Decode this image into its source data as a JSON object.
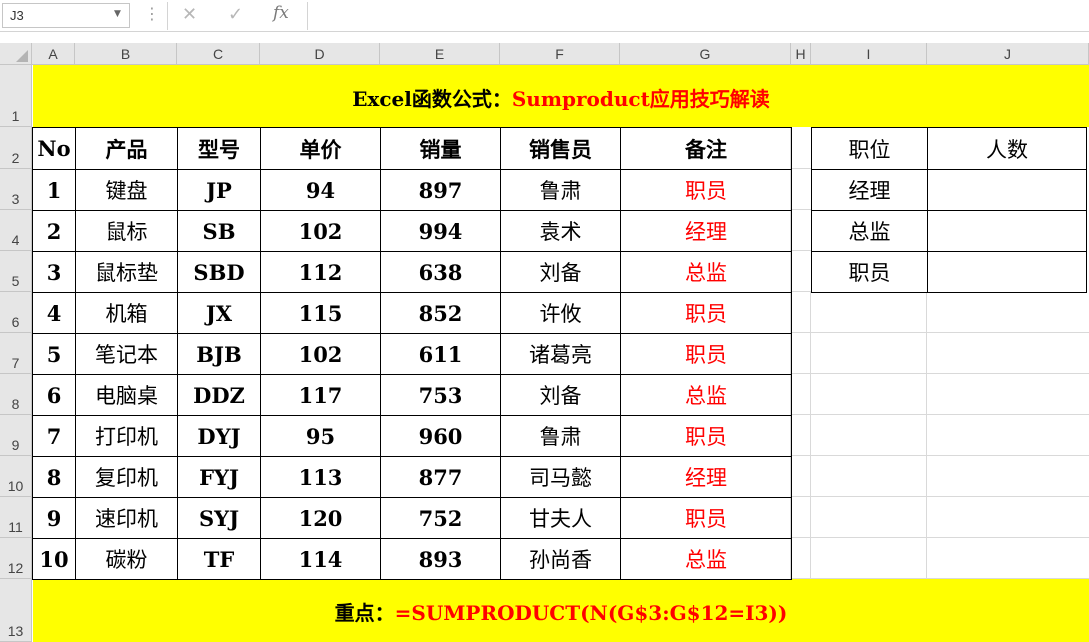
{
  "formula_bar": {
    "name_box": "J3",
    "cancel_icon": "✕",
    "enter_icon": "✓",
    "fx_label": "fx",
    "formula": ""
  },
  "columns": [
    "A",
    "B",
    "C",
    "D",
    "E",
    "F",
    "G",
    "H",
    "I",
    "J"
  ],
  "rows": [
    "1",
    "2",
    "3",
    "4",
    "5",
    "6",
    "7",
    "8",
    "9",
    "10",
    "11",
    "12",
    "13"
  ],
  "title": {
    "part1": "Excel函数公式：",
    "part2": "Sumproduct应用技巧解读"
  },
  "main_table": {
    "headers": [
      "No",
      "产品",
      "型号",
      "单价",
      "销量",
      "销售员",
      "备注"
    ],
    "rows": [
      [
        "1",
        "键盘",
        "JP",
        "94",
        "897",
        "鲁肃",
        "职员"
      ],
      [
        "2",
        "鼠标",
        "SB",
        "102",
        "994",
        "袁术",
        "经理"
      ],
      [
        "3",
        "鼠标垫",
        "SBD",
        "112",
        "638",
        "刘备",
        "总监"
      ],
      [
        "4",
        "机箱",
        "JX",
        "115",
        "852",
        "许攸",
        "职员"
      ],
      [
        "5",
        "笔记本",
        "BJB",
        "102",
        "611",
        "诸葛亮",
        "职员"
      ],
      [
        "6",
        "电脑桌",
        "DDZ",
        "117",
        "753",
        "刘备",
        "总监"
      ],
      [
        "7",
        "打印机",
        "DYJ",
        "95",
        "960",
        "鲁肃",
        "职员"
      ],
      [
        "8",
        "复印机",
        "FYJ",
        "113",
        "877",
        "司马懿",
        "经理"
      ],
      [
        "9",
        "速印机",
        "SYJ",
        "120",
        "752",
        "甘夫人",
        "职员"
      ],
      [
        "10",
        "碳粉",
        "TF",
        "114",
        "893",
        "孙尚香",
        "总监"
      ]
    ]
  },
  "side_table": {
    "headers": [
      "职位",
      "人数"
    ],
    "rows": [
      [
        "经理",
        ""
      ],
      [
        "总监",
        ""
      ],
      [
        "职员",
        ""
      ]
    ]
  },
  "footer": {
    "part1": "重点：",
    "part2": "=SUMPRODUCT(N(G$3:G$12=I3))"
  }
}
